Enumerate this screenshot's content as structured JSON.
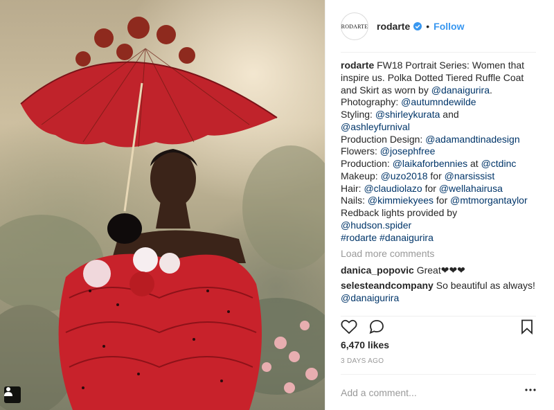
{
  "post": {
    "author": {
      "username": "rodarte",
      "avatar_text": "RODARTE",
      "verified": true,
      "follow_label": "Follow",
      "separator": "•"
    },
    "caption": {
      "author": "rodarte",
      "parts": [
        {
          "t": "FW18 Portrait Series: Women that inspire us. Polka Dotted Tiered Ruffle Coat and Skirt as worn by "
        },
        {
          "link": "@danaigurira"
        },
        {
          "t": "."
        },
        {
          "br": true
        },
        {
          "t": "Photography: "
        },
        {
          "link": "@autumndewilde"
        },
        {
          "br": true
        },
        {
          "t": "Styling: "
        },
        {
          "link": "@shirleykurata"
        },
        {
          "t": " and"
        },
        {
          "br": true
        },
        {
          "link": "@ashleyfurnival"
        },
        {
          "br": true
        },
        {
          "t": "Production Design: "
        },
        {
          "link": "@adamandtinadesign"
        },
        {
          "br": true
        },
        {
          "t": "Flowers: "
        },
        {
          "link": "@josephfree"
        },
        {
          "br": true
        },
        {
          "t": "Production: "
        },
        {
          "link": "@laikaforbennies"
        },
        {
          "t": " at "
        },
        {
          "link": "@ctdinc"
        },
        {
          "br": true
        },
        {
          "t": "Makeup: "
        },
        {
          "link": "@uzo2018"
        },
        {
          "t": " for "
        },
        {
          "link": "@narsissist"
        },
        {
          "br": true
        },
        {
          "t": "Hair:  "
        },
        {
          "link": "@claudiolazo"
        },
        {
          "t": " for "
        },
        {
          "link": "@wellahairusa"
        },
        {
          "br": true
        },
        {
          "t": "Nails: "
        },
        {
          "link": "@kimmiekyees"
        },
        {
          "t": " for "
        },
        {
          "link": "@mtmorgantaylor"
        },
        {
          "br": true
        },
        {
          "t": "Redback lights provided by"
        },
        {
          "br": true
        },
        {
          "link": "@hudson.spider"
        },
        {
          "br": true
        },
        {
          "link": "#rodarte"
        },
        {
          "t": " "
        },
        {
          "link": "#danaigurira"
        }
      ]
    },
    "load_more_label": "Load more comments",
    "comments": [
      {
        "user": "danica_popovic",
        "text": "Great❤❤❤"
      },
      {
        "user": "selesteandcompany",
        "text": "So beautiful as always! ",
        "mention": "@danaigurira"
      }
    ],
    "likes_text": "6,470 likes",
    "posted_ago": "3 DAYS AGO",
    "add_comment_placeholder": "Add a comment...",
    "more_icon": "more-options-icon",
    "icons": [
      "heart-icon",
      "comment-icon",
      "bookmark-icon",
      "user-tag-icon"
    ],
    "colors": {
      "link": "#003569",
      "follow": "#3897f0",
      "muted": "#999999",
      "verified": "#3897f0"
    }
  }
}
